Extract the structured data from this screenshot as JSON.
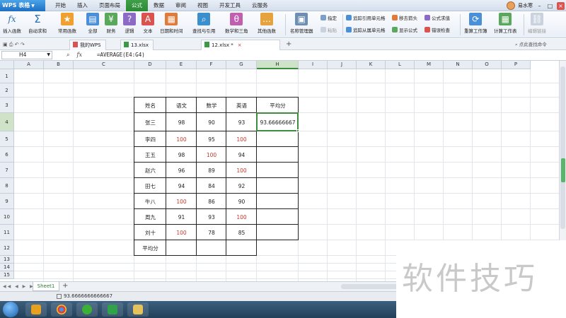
{
  "app": {
    "name": "WPS 表格"
  },
  "menu": [
    "开始",
    "插入",
    "页面布局",
    "公式",
    "数据",
    "审阅",
    "视图",
    "开发工具",
    "云服务"
  ],
  "menu_active_index": 3,
  "user": {
    "name": "易水寒"
  },
  "ribbon": {
    "insert_function": "插入函数",
    "autosum": "自动求和",
    "common_functions": "常用函数",
    "all": "全部",
    "finance": "财务",
    "logic": "逻辑",
    "text": "文本",
    "datetime": "日期和时间",
    "lookup": "查找与引用",
    "math": "数学和三角",
    "other": "其他函数",
    "name_manager": "名称管理器",
    "specify": "指定",
    "paste": "粘贴",
    "trace_precedents": "追踪引用单元格",
    "trace_dependents": "追踪从属单元格",
    "remove_arrows": "移去箭头",
    "show_formulas": "显示公式",
    "formula_eval": "公式求值",
    "error_check": "错误检查",
    "recalc_workbook": "重算工作簿",
    "calc_sheet": "计算工作表",
    "edit_links": "编辑链接"
  },
  "tabs": {
    "my_wps": "我的WPS",
    "file1": "13.xlsx",
    "file2": "12.xlsx *",
    "find_cmd": "点此查找命令"
  },
  "formula_bar": {
    "cell_ref": "H4",
    "formula": "=AVERAGE(E4:G4)"
  },
  "columns": [
    "A",
    "B",
    "C",
    "D",
    "E",
    "F",
    "G",
    "H",
    "I",
    "J",
    "K",
    "L",
    "M",
    "N",
    "O",
    "P"
  ],
  "rows": [
    "1",
    "2",
    "3",
    "4",
    "5",
    "6",
    "7",
    "8",
    "9",
    "10",
    "11",
    "12",
    "13",
    "14",
    "15"
  ],
  "table": {
    "headers": [
      "姓名",
      "语文",
      "数学",
      "英语",
      "平均分"
    ],
    "rows": [
      {
        "name": "张三",
        "chinese": "98",
        "math": "90",
        "english": "93",
        "avg": "93.66666667"
      },
      {
        "name": "李四",
        "chinese": "100",
        "math": "95",
        "english": "100",
        "avg": ""
      },
      {
        "name": "王五",
        "chinese": "98",
        "math": "100",
        "english": "94",
        "avg": ""
      },
      {
        "name": "赵六",
        "chinese": "96",
        "math": "89",
        "english": "100",
        "avg": ""
      },
      {
        "name": "田七",
        "chinese": "94",
        "math": "84",
        "english": "92",
        "avg": ""
      },
      {
        "name": "牛八",
        "chinese": "100",
        "math": "86",
        "english": "90",
        "avg": ""
      },
      {
        "name": "周九",
        "chinese": "91",
        "math": "93",
        "english": "100",
        "avg": ""
      },
      {
        "name": "刘十",
        "chinese": "100",
        "math": "78",
        "english": "85",
        "avg": ""
      }
    ],
    "footer_label": "平均分"
  },
  "sheet_tab": "Sheet1",
  "status": {
    "value": "93.6666666666667"
  },
  "watermark": "软件技巧",
  "colors": {
    "accent_green": "#3c8d3f",
    "value_red": "#c0392b",
    "wps_blue": "#1d6fc2"
  }
}
